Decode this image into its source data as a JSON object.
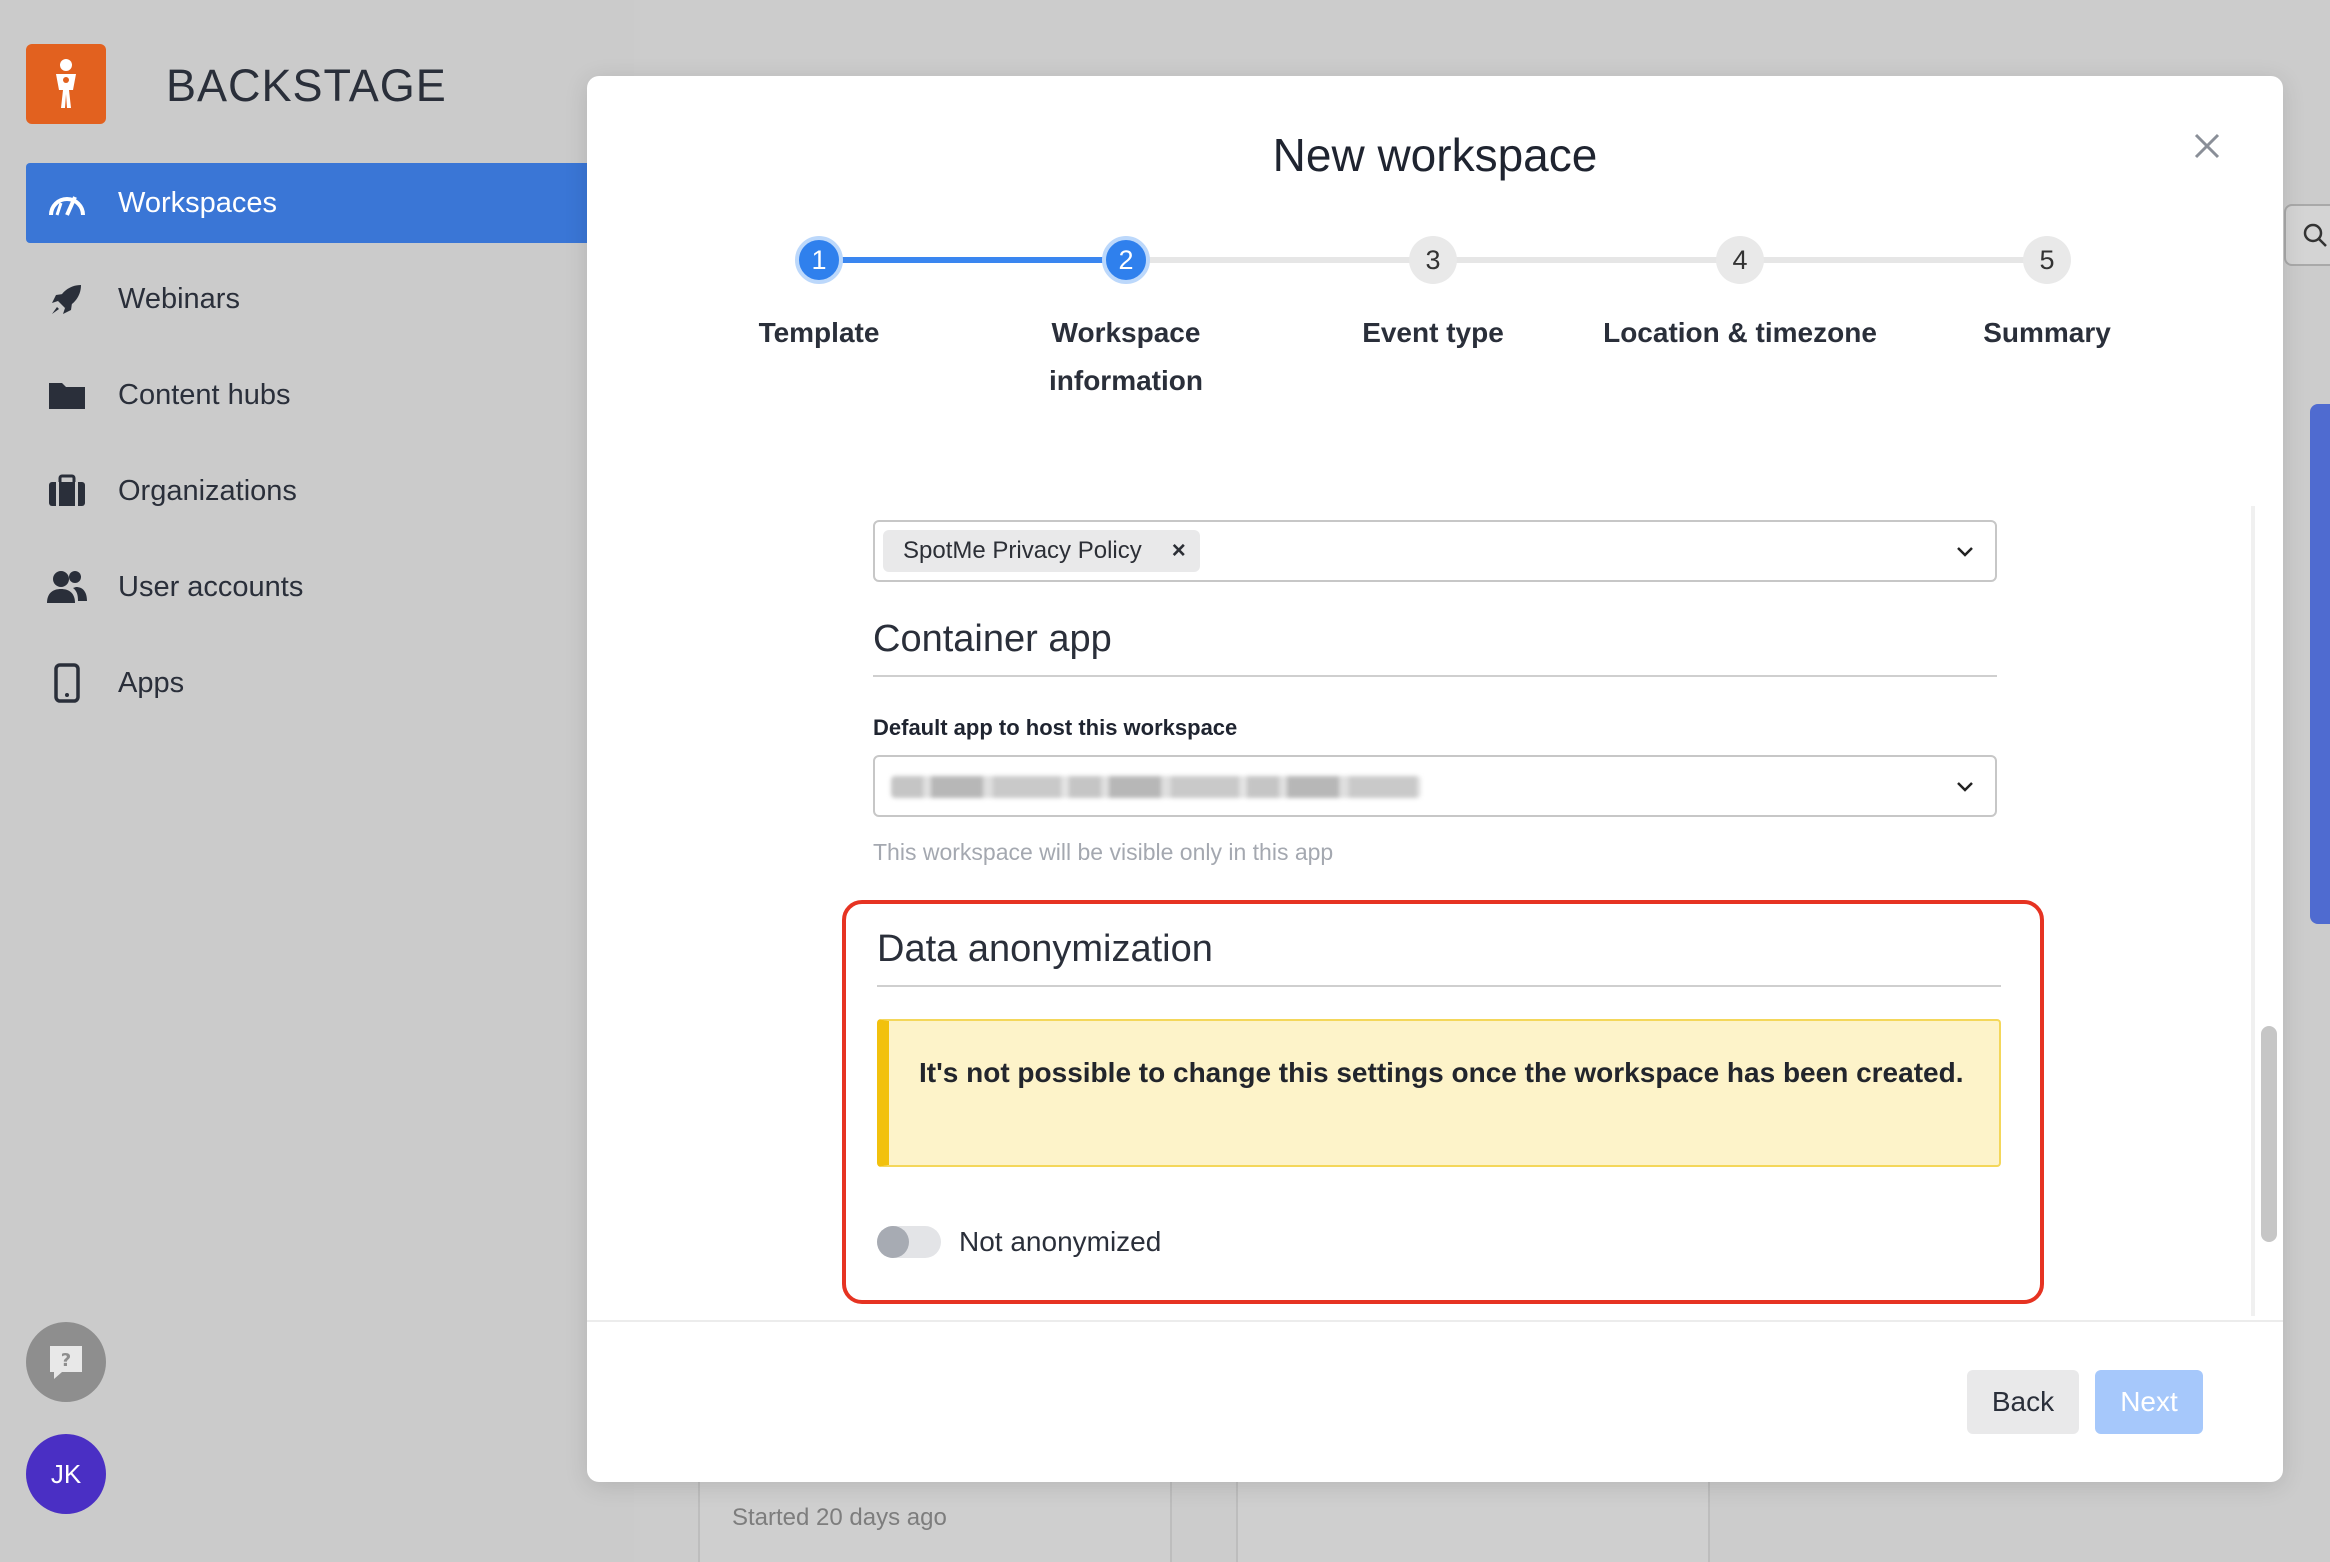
{
  "app": {
    "brand": "BACKSTAGE"
  },
  "sidebar": {
    "items": [
      {
        "label": "Workspaces",
        "icon": "speedometer-icon",
        "active": true
      },
      {
        "label": "Webinars",
        "icon": "rocket-icon",
        "active": false
      },
      {
        "label": "Content hubs",
        "icon": "folder-icon",
        "active": false
      },
      {
        "label": "Organizations",
        "icon": "briefcase-icon",
        "active": false
      },
      {
        "label": "User accounts",
        "icon": "users-icon",
        "active": false
      },
      {
        "label": "Apps",
        "icon": "phone-icon",
        "active": false
      }
    ],
    "help_icon": "help-icon",
    "avatar_initials": "JK"
  },
  "background": {
    "card_status": "Started 20 days ago"
  },
  "modal": {
    "title": "New workspace",
    "steps": [
      {
        "number": "1",
        "label": "Template",
        "state": "done"
      },
      {
        "number": "2",
        "label": "Workspace information",
        "state": "current"
      },
      {
        "number": "3",
        "label": "Event type",
        "state": "pending"
      },
      {
        "number": "4",
        "label": "Location & timezone",
        "state": "pending"
      },
      {
        "number": "5",
        "label": "Summary",
        "state": "pending"
      }
    ],
    "privacy_policy_chip": "SpotMe Privacy Policy",
    "container_app": {
      "title": "Container app",
      "field_label": "Default app to host this workspace",
      "hint": "This workspace will be visible only in this app"
    },
    "anonymization": {
      "title": "Data anonymization",
      "warning": "It's not possible to change this settings once the workspace has been created.",
      "toggle_label": "Not anonymized",
      "toggle_on": false
    },
    "buttons": {
      "back": "Back",
      "next": "Next"
    }
  },
  "colors": {
    "accent": "#2f80ed",
    "sidebar_active": "#3a76d6",
    "logo": "#e2611f",
    "highlight_border": "#e63322",
    "warning_bg": "#fdf3c9",
    "warning_bar": "#f2c10d",
    "avatar": "#4a2fc4"
  }
}
